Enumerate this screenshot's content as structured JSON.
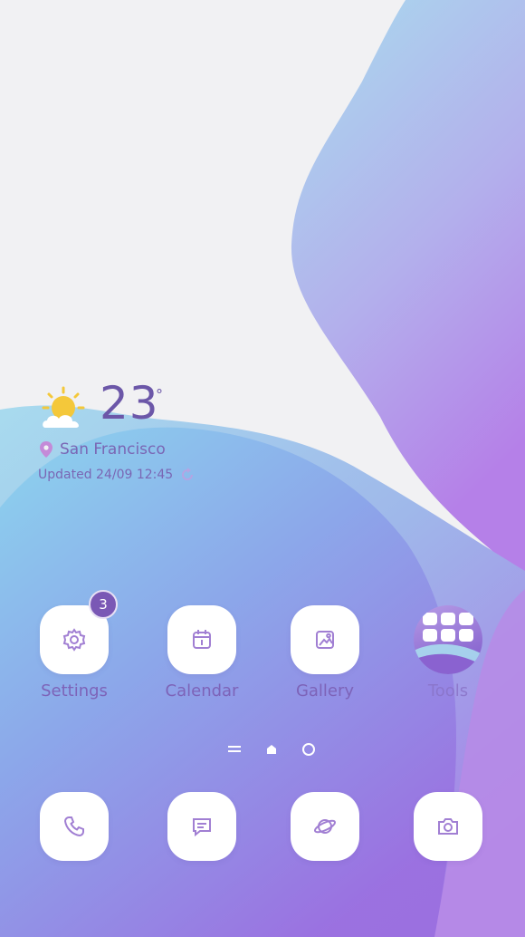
{
  "weather": {
    "temperature": "23",
    "unit": "°",
    "location": "San Francisco",
    "updated": "Updated 24/09 12:45",
    "icon": "partly-sunny-icon"
  },
  "apps": [
    {
      "label": "Settings",
      "icon": "gear-icon",
      "badge": "3"
    },
    {
      "label": "Calendar",
      "icon": "calendar-icon"
    },
    {
      "label": "Gallery",
      "icon": "image-icon"
    },
    {
      "label": "Tools",
      "icon": "folder-icon"
    }
  ],
  "dock": [
    {
      "icon": "phone-icon"
    },
    {
      "icon": "message-icon"
    },
    {
      "icon": "browser-icon"
    },
    {
      "icon": "camera-icon"
    }
  ],
  "colors": {
    "accent": "#7a58b5",
    "label": "#7d63b8",
    "wallpaper_cyan": "#9fd8ef",
    "wallpaper_purple": "#9a6fe0"
  }
}
